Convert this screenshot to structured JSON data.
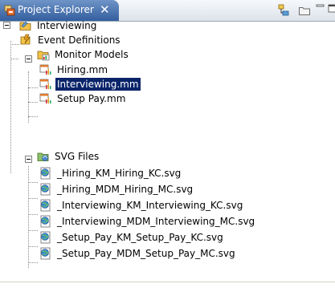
{
  "view": {
    "title": "Project Explorer",
    "close_glyph": "✕",
    "toolbar_icons": [
      "link-with-editor-icon",
      "collapse-all-icon",
      "minimize-icon",
      "maximize-icon"
    ]
  },
  "tree": {
    "project": {
      "label": "Interviewing",
      "icon": "project-folder-icon",
      "expanded": true
    },
    "event_definitions": {
      "label": "Event Definitions",
      "icon": "event-definitions-icon"
    },
    "monitor_models": {
      "label": "Monitor Models",
      "icon": "monitor-models-folder-icon",
      "expanded": true,
      "items": [
        {
          "label": "Hiring.mm",
          "icon": "monitor-model-file-icon"
        },
        {
          "label": "Interviewing.mm",
          "icon": "monitor-model-file-icon",
          "selected": true
        },
        {
          "label": "Setup Pay.mm",
          "icon": "monitor-model-file-icon"
        }
      ]
    },
    "svg_files": {
      "label": "SVG Files",
      "icon": "svg-folder-icon",
      "expanded": true,
      "items": [
        {
          "label": "_Hiring_KM_Hiring_KC.svg",
          "icon": "svg-file-icon"
        },
        {
          "label": "_Hiring_MDM_Hiring_MC.svg",
          "icon": "svg-file-icon"
        },
        {
          "label": "_Interviewing_KM_Interviewing_KC.svg",
          "icon": "svg-file-icon"
        },
        {
          "label": "_Interviewing_MDM_Interviewing_MC.svg",
          "icon": "svg-file-icon"
        },
        {
          "label": "_Setup_Pay_KM_Setup_Pay_KC.svg",
          "icon": "svg-file-icon"
        },
        {
          "label": "_Setup_Pay_MDM_Setup_Pay_MC.svg",
          "icon": "svg-file-icon"
        }
      ]
    }
  },
  "colors": {
    "tab_active": "#4a74b0",
    "selection": "#0a246a",
    "folder": "#e8b43c"
  }
}
